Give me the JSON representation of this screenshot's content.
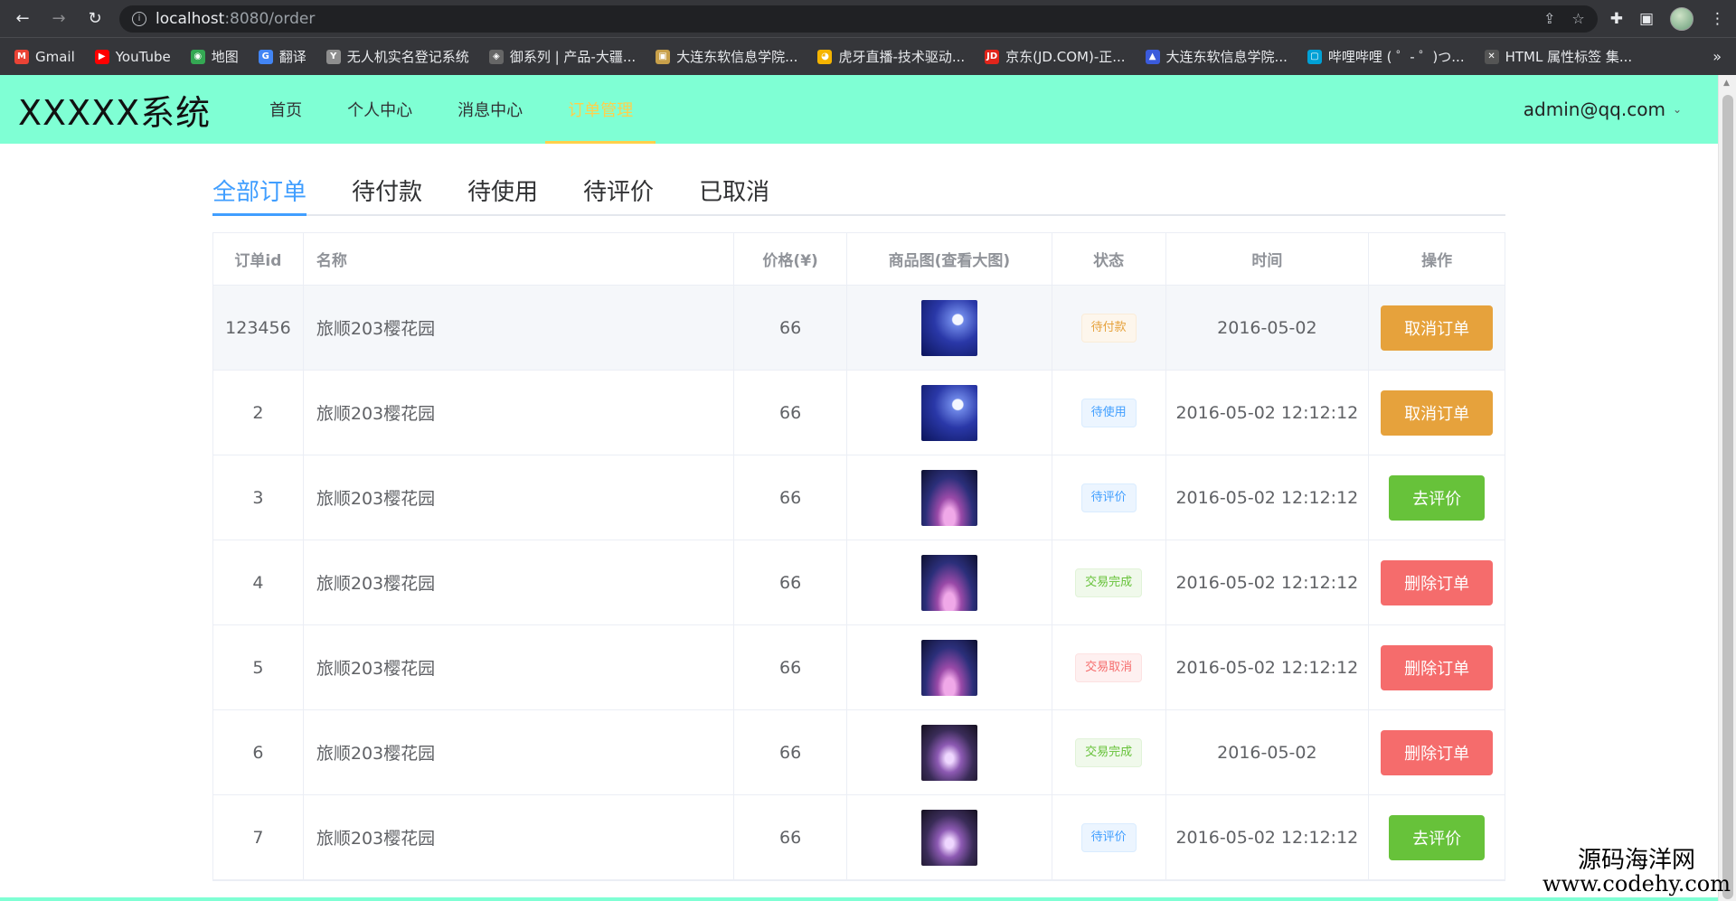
{
  "browser": {
    "url_host": "localhost",
    "url_rest": ":8080/order",
    "bookmarks": [
      {
        "label": "Gmail",
        "icon": "gmail-icon",
        "glyph": "M",
        "color": "#ea4335"
      },
      {
        "label": "YouTube",
        "icon": "youtube-icon",
        "glyph": "▶",
        "color": "#ff0000"
      },
      {
        "label": "地图",
        "icon": "maps-icon",
        "glyph": "◉",
        "color": "#34a853"
      },
      {
        "label": "翻译",
        "icon": "translate-icon",
        "glyph": "G",
        "color": "#4285f4"
      },
      {
        "label": "无人机实名登记系统",
        "icon": "drone-site-icon",
        "glyph": "Y",
        "color": "#8e8e8e"
      },
      {
        "label": "御系列 | 产品-大疆...",
        "icon": "dji-icon",
        "glyph": "◈",
        "color": "#666"
      },
      {
        "label": "大连东软信息学院...",
        "icon": "school-icon",
        "glyph": "▣",
        "color": "#c8a04a"
      },
      {
        "label": "虎牙直播-技术驱动...",
        "icon": "huya-icon",
        "glyph": "◕",
        "color": "#f5b400"
      },
      {
        "label": "京东(JD.COM)-正...",
        "icon": "jd-icon",
        "glyph": "JD",
        "color": "#e1251b"
      },
      {
        "label": "大连东软信息学院...",
        "icon": "school-icon",
        "glyph": "▲",
        "color": "#3b5bdb"
      },
      {
        "label": "哔哩哔哩 ( ゜- ゜)つ...",
        "icon": "bilibili-icon",
        "glyph": "▢",
        "color": "#00a1d6"
      },
      {
        "label": "HTML 属性标签 集...",
        "icon": "html-site-icon",
        "glyph": "✕",
        "color": "#555"
      }
    ],
    "more": "»"
  },
  "header": {
    "logo": "XXXXX系统",
    "nav": [
      "首页",
      "个人中心",
      "消息中心",
      "订单管理"
    ],
    "user": "admin@qq.com"
  },
  "tabs": [
    "全部订单",
    "待付款",
    "待使用",
    "待评价",
    "已取消"
  ],
  "table": {
    "columns": [
      "订单id",
      "名称",
      "价格(¥)",
      "商品图(查看大图)",
      "状态",
      "时间",
      "操作"
    ],
    "rows": [
      {
        "id": "123456",
        "name": "旅顺203樱花园",
        "price": "66",
        "thumb": "a",
        "status": "待付款",
        "status_type": "warning",
        "time": "2016-05-02",
        "action": "取消订单",
        "action_type": "warning"
      },
      {
        "id": "2",
        "name": "旅顺203樱花园",
        "price": "66",
        "thumb": "a",
        "status": "待使用",
        "status_type": "info",
        "time": "2016-05-02 12:12:12",
        "action": "取消订单",
        "action_type": "warning"
      },
      {
        "id": "3",
        "name": "旅顺203樱花园",
        "price": "66",
        "thumb": "b",
        "status": "待评价",
        "status_type": "info",
        "time": "2016-05-02 12:12:12",
        "action": "去评价",
        "action_type": "success"
      },
      {
        "id": "4",
        "name": "旅顺203樱花园",
        "price": "66",
        "thumb": "b",
        "status": "交易完成",
        "status_type": "success",
        "time": "2016-05-02 12:12:12",
        "action": "删除订单",
        "action_type": "danger"
      },
      {
        "id": "5",
        "name": "旅顺203樱花园",
        "price": "66",
        "thumb": "b",
        "status": "交易取消",
        "status_type": "danger",
        "time": "2016-05-02 12:12:12",
        "action": "删除订单",
        "action_type": "danger"
      },
      {
        "id": "6",
        "name": "旅顺203樱花园",
        "price": "66",
        "thumb": "c",
        "status": "交易完成",
        "status_type": "success",
        "time": "2016-05-02",
        "action": "删除订单",
        "action_type": "danger"
      },
      {
        "id": "7",
        "name": "旅顺203樱花园",
        "price": "66",
        "thumb": "c",
        "status": "待评价",
        "status_type": "info",
        "time": "2016-05-02 12:12:12",
        "action": "去评价",
        "action_type": "success"
      }
    ]
  },
  "watermark": {
    "line1": "源码海洋网",
    "line2": "www.codehy.com"
  },
  "colors": {
    "header_bg": "#7fffd4",
    "active_nav": "#ffd04b",
    "active_tab": "#409eff"
  }
}
